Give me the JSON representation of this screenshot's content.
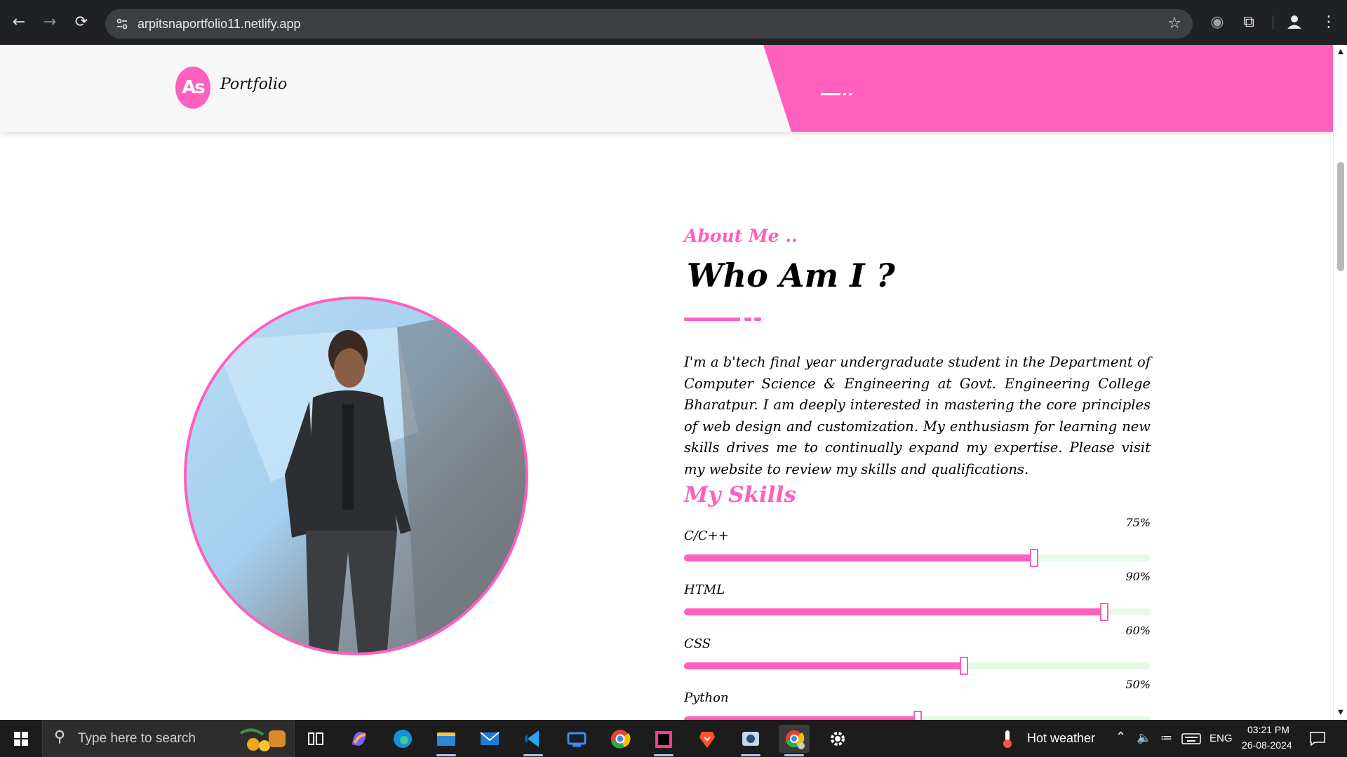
{
  "browser": {
    "url": "arpitsnaportfolio11.netlify.app",
    "icons": [
      "back-arrow-icon",
      "forward-arrow-icon",
      "reload-icon",
      "site-info-icon",
      "bookmark-star-icon",
      "extension-icon",
      "puzzle-icon",
      "profile-icon",
      "kebab-menu-icon"
    ]
  },
  "site": {
    "logo_initials": "As",
    "logo_label": "Portfolio",
    "accent": "#ff5fbd"
  },
  "about": {
    "tag": "About Me ..",
    "title": "Who Am I ?",
    "bio": "I'm a b'tech final year undergraduate student in the Department of Computer Science & Engineering at Govt. Engineering College Bharatpur. I am deeply interested in mastering the core principles of web design and customization. My enthusiasm for learning new skills drives me to continually expand my expertise. Please visit my website to review my skills and qualifications."
  },
  "skills": {
    "title": "My Skills",
    "items": [
      {
        "name": "C/C++",
        "percent_label": "75%",
        "level": 75
      },
      {
        "name": "HTML",
        "percent_label": "90%",
        "level": 90
      },
      {
        "name": "CSS",
        "percent_label": "60%",
        "level": 60
      },
      {
        "name": "Python",
        "percent_label": "50%",
        "level": 50
      }
    ]
  },
  "taskbar": {
    "search_placeholder": "Type here to search",
    "apps": [
      "task-view-icon",
      "copilot-icon",
      "edge-icon",
      "file-explorer-icon",
      "mail-icon",
      "vscode-icon",
      "remote-desktop-icon",
      "chrome-icon",
      "jetbrains-icon",
      "brave-icon",
      "media-icon",
      "chrome-profile-icon",
      "settings-icon"
    ],
    "weather": "Hot weather",
    "language": "ENG",
    "time": "03:21 PM",
    "date": "26-08-2024"
  }
}
